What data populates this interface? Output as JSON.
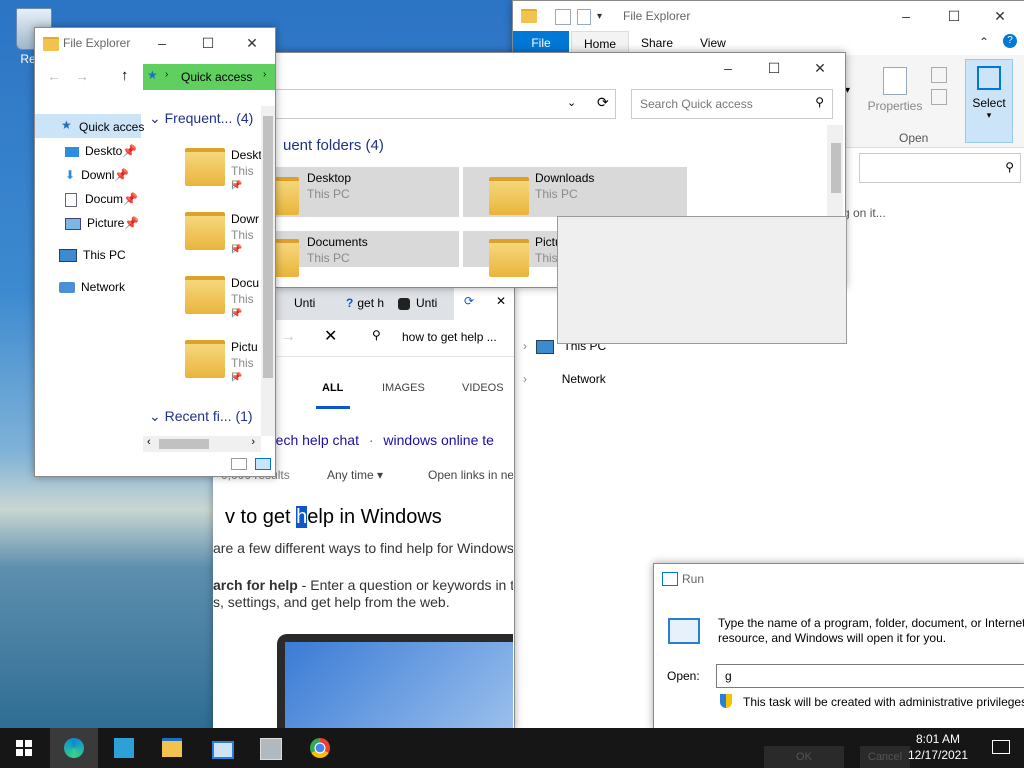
{
  "desktop": {
    "recycle_label": "Recy"
  },
  "fe1": {
    "title": "File Explorer",
    "address": "Quick access",
    "nav": [
      {
        "label": "Quick acces",
        "icon": "star-icon"
      },
      {
        "label": "Deskto",
        "icon": "desktop-icon"
      },
      {
        "label": "Downl",
        "icon": "download-icon"
      },
      {
        "label": "Docum",
        "icon": "document-icon"
      },
      {
        "label": "Picture",
        "icon": "picture-icon"
      },
      {
        "label": "This PC",
        "icon": "computer-icon"
      },
      {
        "label": "Network",
        "icon": "network-icon"
      }
    ],
    "frequent_header": "Frequent...",
    "frequent_count": "(4)",
    "items": [
      {
        "name": "Deskt",
        "sub": "This P"
      },
      {
        "name": "Dowr",
        "sub": "This P"
      },
      {
        "name": "Docu",
        "sub": "This P"
      },
      {
        "name": "Pictu",
        "sub": "This P"
      }
    ],
    "recent_header": "Recent fi...",
    "recent_count": "(1)"
  },
  "fe2": {
    "search_placeholder": "Search Quick access",
    "frequent_header": "uent folders (4)",
    "tiles": [
      {
        "name": "Desktop",
        "sub": "This PC"
      },
      {
        "name": "Downloads",
        "sub": "This PC"
      },
      {
        "name": "Documents",
        "sub": "This PC"
      },
      {
        "name": "Pictu",
        "sub": "This"
      }
    ]
  },
  "fe3": {
    "title": "File Explorer",
    "tabs": [
      "File",
      "Home",
      "Share",
      "View"
    ],
    "ribbon": {
      "properties": "Properties",
      "open": "Open",
      "select": "Select"
    },
    "hint": "g on it...",
    "nav": [
      "This PC",
      "Network"
    ]
  },
  "browser": {
    "tabs": [
      "Unti",
      "get h",
      "Unti"
    ],
    "search_query": "how to get help ...",
    "filters": [
      "ALL",
      "IMAGES",
      "VIDEOS"
    ],
    "related": [
      "ows tech help chat",
      "·",
      "windows online te"
    ],
    "results_count": "0,000 results",
    "any_time": "Any time",
    "open_links": "Open links in ne",
    "result_title_before": "v to get ",
    "result_title_hl": "h",
    "result_title_after": "elp in Windows",
    "snippet1": "are a few different ways to find help for Windows",
    "snippet2_bold": "arch for help",
    "snippet2_rest": " - Enter a question or keywords in th",
    "snippet3": "s, settings, and get help from the web."
  },
  "run": {
    "title": "Run",
    "desc1": "Type the name of a program, folder, document, or Internet",
    "desc2": "resource, and Windows will open it for you.",
    "open_label": "Open:",
    "value": "g",
    "admin": "This task will be created with administrative privileges."
  },
  "taskbar": {
    "time": "8:01 AM",
    "date": "12/17/2021",
    "ok": "OK",
    "cancel": "Cancel"
  },
  "colors": {
    "accent": "#0078d7",
    "qa_green": "#5fcf5f",
    "taskbar": "#161616"
  }
}
